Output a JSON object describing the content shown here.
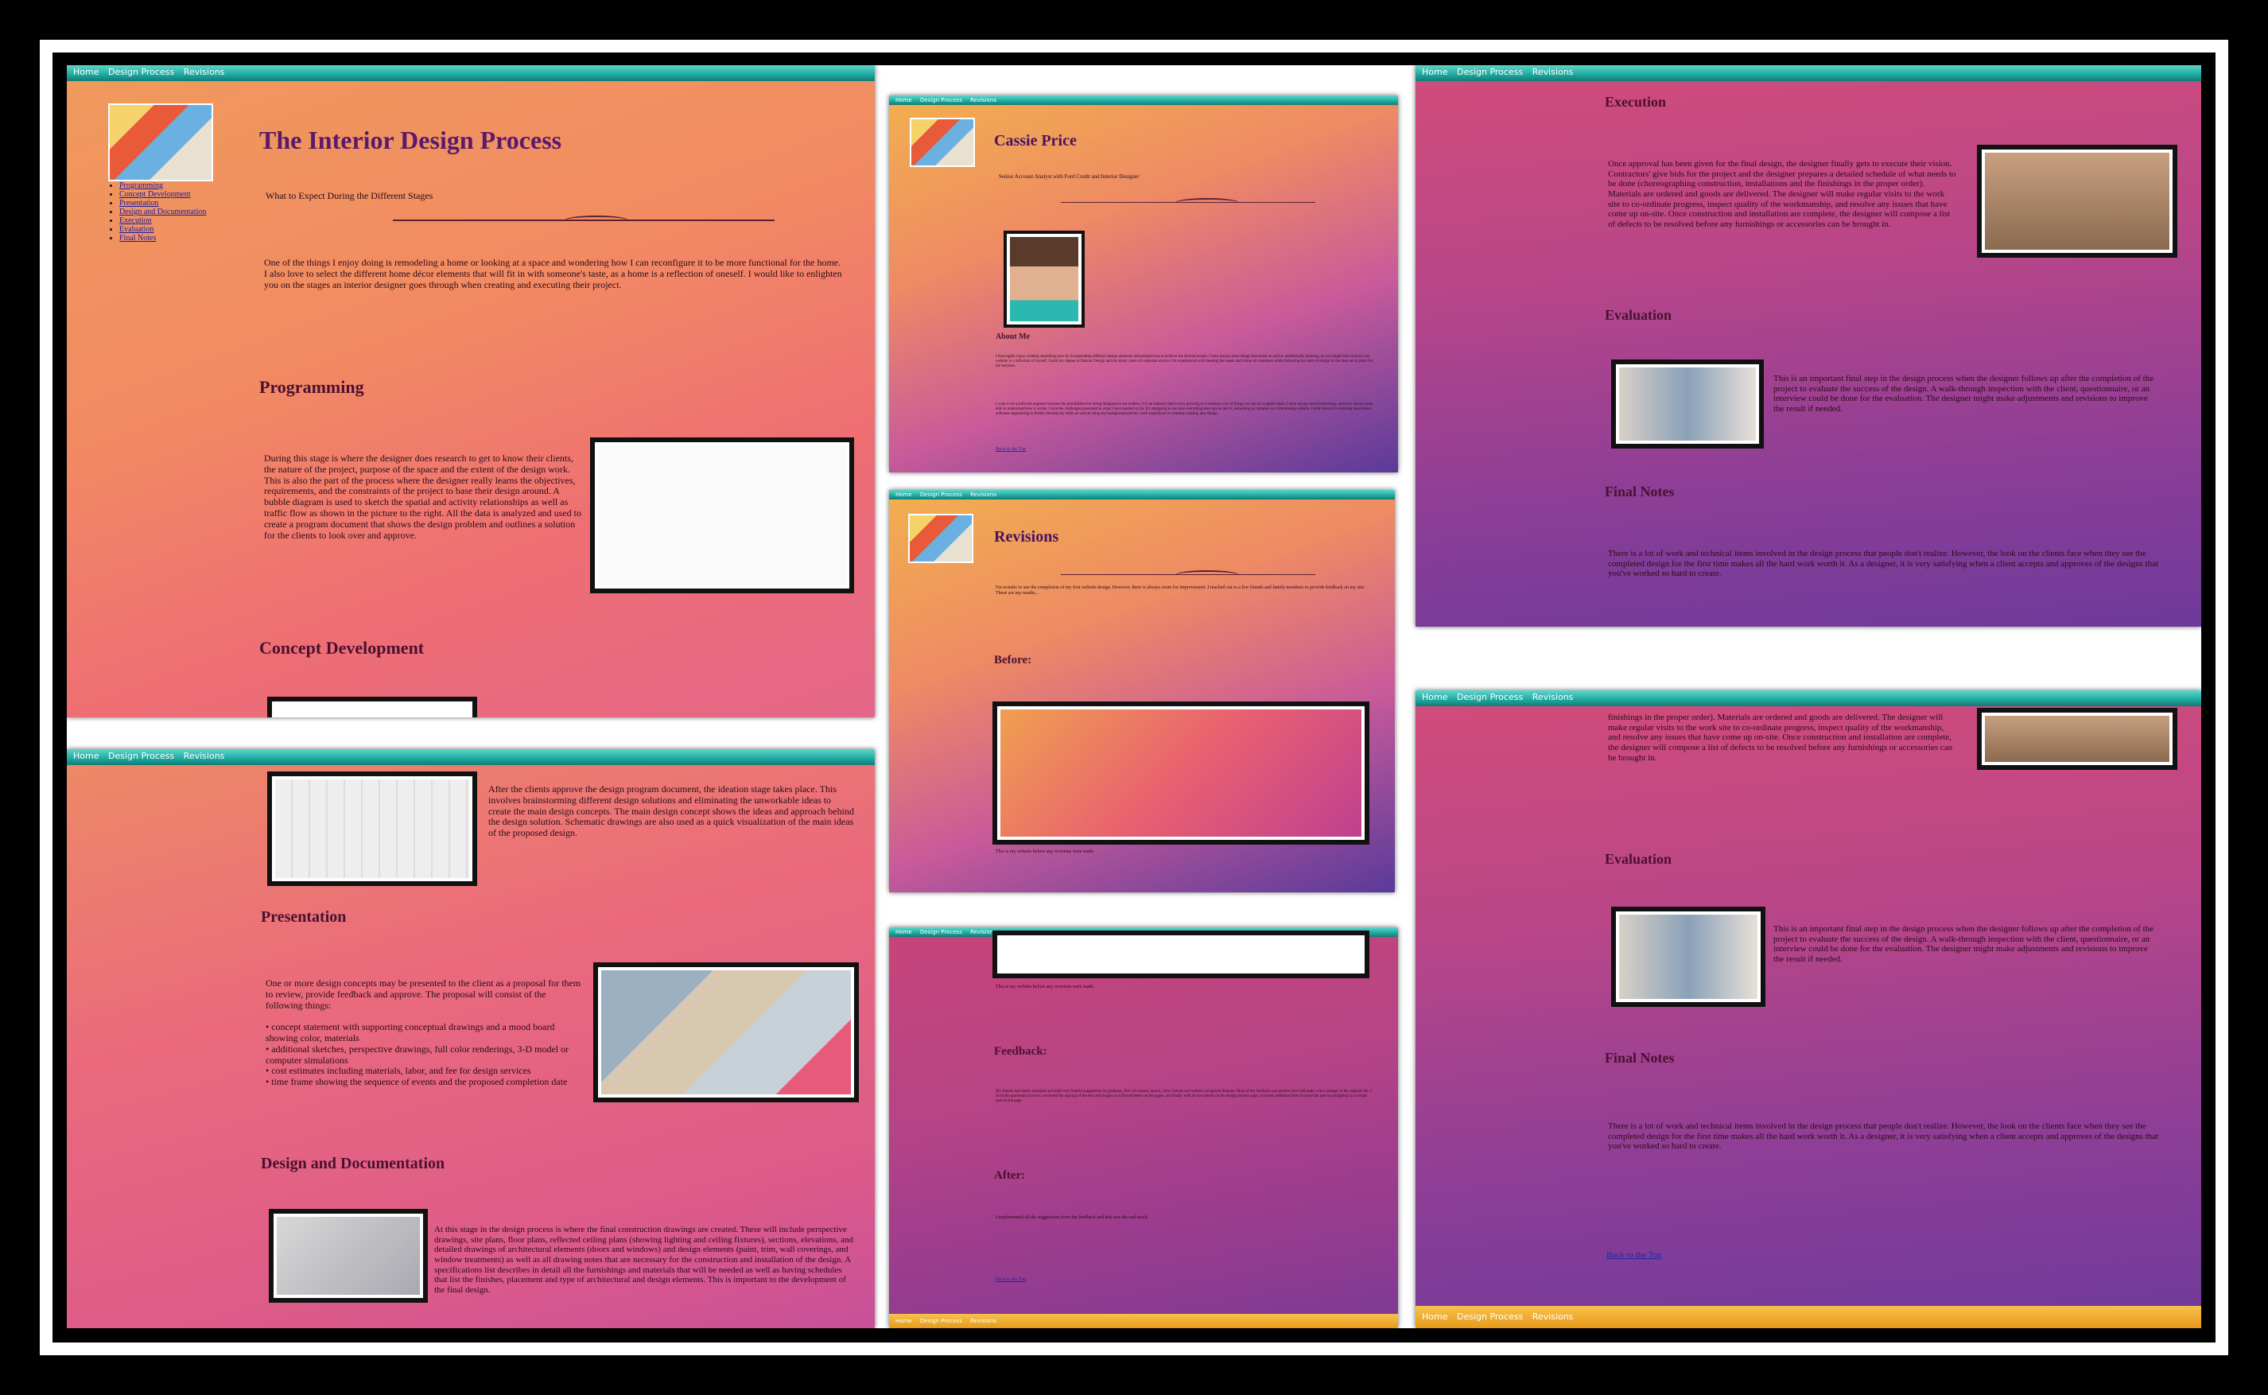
{
  "nav": {
    "home": "Home",
    "design_process": "Design Process",
    "revisions": "Revisions"
  },
  "design": {
    "title": "The Interior Design Process",
    "subtitle": "What to Expect During the Different Stages",
    "toc": [
      "Programming",
      "Concept Development",
      "Presentation",
      "Design and Documentation",
      "Execution",
      "Evaluation",
      "Final Notes"
    ],
    "intro": "One of the things I enjoy doing is remodeling a home or looking at a space and wondering how I can reconfigure it to be more functional for the home. I also love to select the different home décor elements that will fit in with someone's taste, as a home is a reflection of oneself. I would like to enlighten you on the stages an interior designer goes through when creating and executing their project.",
    "programming_heading": "Programming",
    "programming_text": "During this stage is where the designer does research to get to know their clients, the nature of the project, purpose of the space and the extent of the design work. This is also the part of the process where the designer really learns the objectives, requirements, and the constraints of the project to base their design around. A bubble diagram is used to sketch the spatial and activity relationships as well as traffic flow as shown in the picture to the right. All the data is analyzed and used to create a program document that shows the design problem and outlines a solution for the clients to look over and approve.",
    "concept_heading": "Concept Development",
    "concept_text": "After the clients approve the design program document, the ideation stage takes place. This involves brainstorming different design solutions and eliminating the unworkable ideas to create the main design concepts. The main design concept shows the ideas and approach behind the design solution. Schematic drawings are also used as a quick visualization of the main ideas of the proposed design.",
    "presentation_heading": "Presentation",
    "presentation_text": "One or more design concepts may be presented to the client as a proposal for them to review, provide feedback and approve. The proposal will consist of the following things:",
    "presentation_bullets": [
      "• concept statement with supporting conceptual drawings and a mood board showing color, materials",
      "• additional sketches, perspective drawings, full color renderings, 3-D model or computer simulations",
      "• cost estimates including materials, labor, and fee for design services",
      "• time frame showing the sequence of events and the proposed completion date"
    ],
    "documentation_heading": "Design and Documentation",
    "documentation_text": "At this stage in the design process is where the final construction drawings are created. These will include perspective drawings, site plans, floor plans, reflected ceiling plans (showing lighting and ceiling fixtures), sections, elevations, and detailed drawings of architectural elements (doors and windows) and design elements (paint, trim, wall coverings, and window treatments) as well as all drawing notes that are necessary for the construction and installation of the design. A specifications list describes in detail all the furnishings and materials that will be needed as well as having schedules that list the finishes, placement and type of architectural and design elements. This is important to the development of the final design.",
    "execution_heading": "Execution",
    "execution_text": "Once approval has been given for the final design, the designer finally gets to execute their vision. Contractors' give bids for the project and the designer prepares a detailed schedule of what needs to be done (choreographing construction, installations and the finishings in the proper order). Materials are ordered and goods are delivered. The designer will make regular visits to the work site to co-ordinate progress, inspect quality of the workmanship, and resolve any issues that have come up on-site. Once construction and installation are complete, the designer will compose a list of defects to be resolved before any furnishings or accessories can be brought in.",
    "execution_text_partial": "finishings in the proper order). Materials are ordered and goods are delivered. The designer will make regular visits to the work site to co-ordinate progress, inspect quality of the workmanship, and resolve any issues that have come up on-site. Once construction and installation are complete, the designer will compose a list of defects to be resolved before any furnishings or accessories can be brought in.",
    "evaluation_heading": "Evaluation",
    "evaluation_text": "This is an important final step in the design process when the designer follows up after the completion of the project to evaluate the success of the design. A walk-through inspection with the client, questionnaire, or an interview could be done for the evaluation. The designer might make adjustments and revisions to improve the result if needed.",
    "final_heading": "Final Notes",
    "final_text": "There is a lot of work and technical items involved in the design process that people don't realize. However, the look on the clients face when they see the completed design for the first time makes all the hard work worth it. As a designer, it is very satisfying when a client accepts and approves of the designs that you've worked so hard to create.",
    "back_to_top": "Back to the Top"
  },
  "about": {
    "name": "Cassie Price",
    "role": "Senior Account Analyst with Ford Credit and Interior Designer",
    "about_heading": "About Me",
    "p1": "I thoroughly enjoy creating something new by incorporating different design elements and perspectives to achieve the desired results. I have always done things functional as well as aesthetically pleasing, as you might have noticed, my website is a reflection of myself. I hold my degree in Interior Design and my many years of corporate service. I'm experienced with meeting the needs and vision of customers while following the rules of design or the ones set in place for the business.",
    "p2": "I want to be a software engineer because the possibilities for being imaginative are endless. It is an industry that is ever growing so it requires a lot of things we use on a regular basis. I have always loved technology and have always been able to understand how it works. I love the challenges presented in what I have learned so far. It's intriguing to see how everything else can tie into it, something as complex as a functioning website. I look forward to learning more about software engineering to further develop my skills as well as using my background and my work experience to continue creating new things.",
    "back_to_top": "Back to the Top"
  },
  "revisions": {
    "title": "Revisions",
    "intro": "I'm ecstatic to see the completion of my first website design. However, there is always room for improvement. I reached out to a few friends and family members to provide feedback on my site. These are my results...",
    "before_heading": "Before:",
    "before_caption": "This is my website before any revisions were made.",
    "feedback_heading": "Feedback:",
    "feedback_text": "My friends and family members provided very helpful suggestions on grammar, flow of content, layout, color choices and website navigation features. Most of the feedback was positive but I did make a few changes to the original site. I fixed the grammatical errors, reworded the spacing of the text and images so it flowed better on the pages, and finally with all the content on the design process page, I created additional links to assist the user in navigating to a certain spot on the page.",
    "after_heading": "After:",
    "after_text": "I implemented all the suggestions from the feedback and this was the end result.",
    "back_to_top": "Back to the Top"
  }
}
